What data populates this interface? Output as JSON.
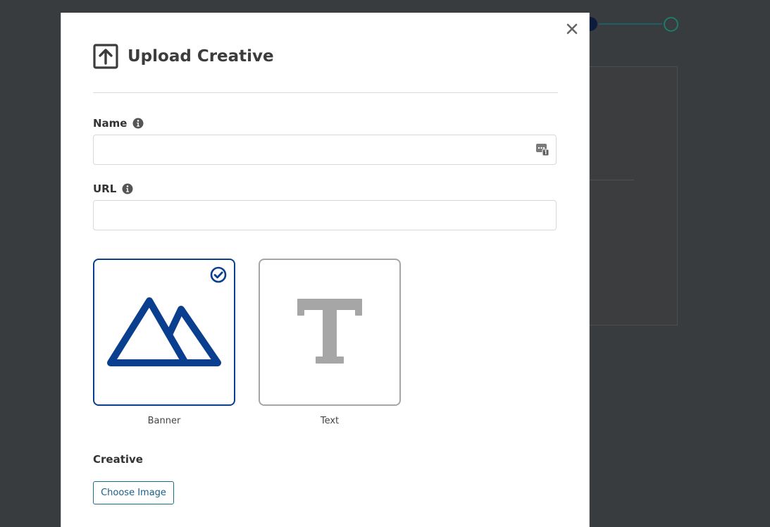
{
  "modal": {
    "title": "Upload Creative",
    "close_icon": "close-icon",
    "title_icon": "upload-arrow-icon"
  },
  "fields": {
    "name": {
      "label": "Name",
      "value": "",
      "placeholder": ""
    },
    "url": {
      "label": "URL",
      "value": "",
      "placeholder": ""
    }
  },
  "creative_types": [
    {
      "label": "Banner",
      "icon": "mountain-image-icon",
      "selected": true
    },
    {
      "label": "Text",
      "icon": "text-type-icon",
      "selected": false
    }
  ],
  "creative": {
    "label": "Creative",
    "button_label": "Choose Image"
  },
  "colors": {
    "accent": "#0a3e8e",
    "unselected": "#a6a6a6",
    "button": "#1a5f86"
  }
}
